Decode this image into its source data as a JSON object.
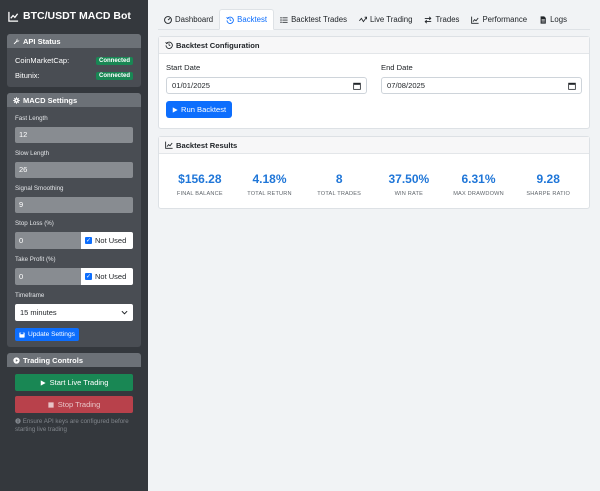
{
  "app": {
    "title": "BTC/USDT MACD Bot"
  },
  "api_status": {
    "title": "API Status",
    "items": [
      {
        "label": "CoinMarketCap:",
        "status": "Connected"
      },
      {
        "label": "Bitunix:",
        "status": "Connected"
      }
    ]
  },
  "macd": {
    "title": "MACD Settings",
    "fast_label": "Fast Length",
    "fast_value": "12",
    "slow_label": "Slow Length",
    "slow_value": "26",
    "signal_label": "Signal Smoothing",
    "signal_value": "9",
    "stop_loss_label": "Stop Loss (%)",
    "stop_loss_value": "0",
    "stop_loss_check": "Not Used",
    "take_profit_label": "Take Profit (%)",
    "take_profit_value": "0",
    "take_profit_check": "Not Used",
    "timeframe_label": "Timeframe",
    "timeframe_value": "15 minutes",
    "update_label": "Update Settings"
  },
  "controls": {
    "title": "Trading Controls",
    "start_label": "Start Live Trading",
    "stop_label": "Stop Trading",
    "hint": "Ensure API keys are configured before starting live trading"
  },
  "tabs": [
    {
      "label": "Dashboard",
      "icon": "dashboard-icon"
    },
    {
      "label": "Backtest",
      "icon": "history-icon",
      "active": true
    },
    {
      "label": "Backtest Trades",
      "icon": "list-icon"
    },
    {
      "label": "Live Trading",
      "icon": "chart-live-icon"
    },
    {
      "label": "Trades",
      "icon": "exchange-icon"
    },
    {
      "label": "Performance",
      "icon": "performance-icon"
    },
    {
      "label": "Logs",
      "icon": "file-icon"
    }
  ],
  "config": {
    "title": "Backtest Configuration",
    "start_label": "Start Date",
    "start_value": "01/01/2025",
    "end_label": "End Date",
    "end_value": "07/08/2025",
    "run_label": "Run Backtest"
  },
  "results": {
    "title": "Backtest Results",
    "metrics": [
      {
        "value": "$156.28",
        "label": "FINAL BALANCE"
      },
      {
        "value": "4.18%",
        "label": "TOTAL RETURN"
      },
      {
        "value": "8",
        "label": "TOTAL TRADES"
      },
      {
        "value": "37.50%",
        "label": "WIN RATE"
      },
      {
        "value": "6.31%",
        "label": "MAX DRAWDOWN"
      },
      {
        "value": "9.28",
        "label": "SHARPE RATIO"
      }
    ]
  },
  "colors": {
    "primary": "#0d6efd",
    "success": "#198754",
    "danger": "#b8414b",
    "metric": "#1f76d8"
  }
}
